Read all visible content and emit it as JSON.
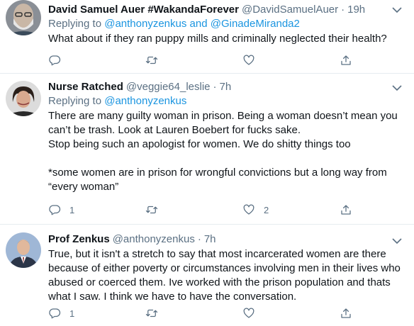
{
  "tweets": [
    {
      "name": "David Samuel Auer #WakandaForever",
      "handle": "@DavidSamuelAuer",
      "separator": "·",
      "time": "19h",
      "replying_prefix": "Replying to",
      "replying_to": [
        "@anthonyzenkus",
        "@GinadeMiranda2"
      ],
      "replying_joiner": "and",
      "text": [
        "What about if they ran puppy mills and criminally neglected their health?"
      ],
      "counts": {
        "reply": "",
        "retweet": "",
        "like": ""
      }
    },
    {
      "name": "Nurse Ratched",
      "handle": "@veggie64_leslie",
      "separator": "·",
      "time": "7h",
      "replying_prefix": "Replying to",
      "replying_to": [
        "@anthonyzenkus"
      ],
      "text": [
        "There are many guilty woman in prison. Being a woman doesn’t mean you can’t be trash. Look at Lauren Boebert for fucks sake.",
        "Stop being such an apologist for women. We do shitty things too",
        "*some women are in prison for wrongful convictions but a long way from “every woman”"
      ],
      "counts": {
        "reply": "1",
        "retweet": "",
        "like": "2"
      }
    },
    {
      "name": "Prof Zenkus",
      "handle": "@anthonyzenkus",
      "separator": "·",
      "time": "7h",
      "text": [
        "True, but it isn't a stretch to say that most incarcerated women are there because of either poverty or circumstances involving men in their lives who abused or coerced them. Ive worked with the prison population and thats what I saw. I think we have to have the conversation."
      ],
      "counts": {
        "reply": "1",
        "retweet": "",
        "like": ""
      }
    }
  ],
  "colors": {
    "text": "#0f1419",
    "secondary": "#5b7083",
    "link": "#1b95e0",
    "divider": "#e6ecf0"
  }
}
